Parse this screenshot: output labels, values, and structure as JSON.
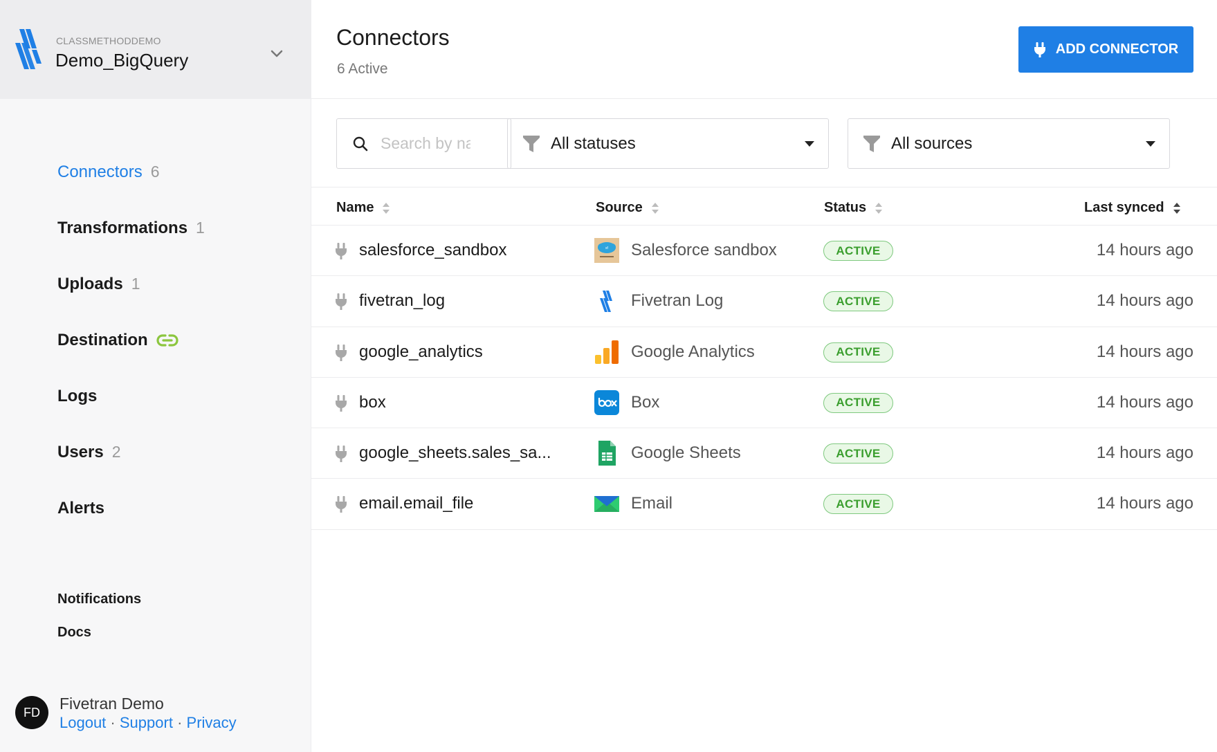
{
  "account": {
    "org": "CLASSMETHODDEMO",
    "destination": "Demo_BigQuery"
  },
  "nav": [
    {
      "label": "Connectors",
      "count": "6"
    },
    {
      "label": "Transformations",
      "count": "1"
    },
    {
      "label": "Uploads",
      "count": "1"
    },
    {
      "label": "Destination",
      "icon": "link-icon"
    },
    {
      "label": "Logs"
    },
    {
      "label": "Users",
      "count": "2"
    },
    {
      "label": "Alerts"
    }
  ],
  "sub_nav": [
    "Notifications",
    "Docs"
  ],
  "user": {
    "initials": "FD",
    "name": "Fivetran Demo",
    "logout": "Logout",
    "support": "Support",
    "privacy": "Privacy",
    "separator": "·"
  },
  "header": {
    "title": "Connectors",
    "subtitle": "6 Active",
    "add_button": "ADD CONNECTOR"
  },
  "filters": {
    "search_placeholder": "Search by name",
    "status": "All statuses",
    "source": "All sources"
  },
  "table": {
    "columns": [
      "Name",
      "Source",
      "Status",
      "Last synced"
    ],
    "rows": [
      {
        "name": "salesforce_sandbox",
        "source": "Salesforce sandbox",
        "icon": "salesforce-icon",
        "status": "ACTIVE",
        "last_synced": "14 hours ago"
      },
      {
        "name": "fivetran_log",
        "source": "Fivetran Log",
        "icon": "fivetran-icon",
        "status": "ACTIVE",
        "last_synced": "14 hours ago"
      },
      {
        "name": "google_analytics",
        "source": "Google Analytics",
        "icon": "google-analytics-icon",
        "status": "ACTIVE",
        "last_synced": "14 hours ago"
      },
      {
        "name": "box",
        "source": "Box",
        "icon": "box-icon",
        "status": "ACTIVE",
        "last_synced": "14 hours ago"
      },
      {
        "name": "google_sheets.sales_sa...",
        "source": "Google Sheets",
        "icon": "google-sheets-icon",
        "status": "ACTIVE",
        "last_synced": "14 hours ago"
      },
      {
        "name": "email.email_file",
        "source": "Email",
        "icon": "email-icon",
        "status": "ACTIVE",
        "last_synced": "14 hours ago"
      }
    ]
  },
  "colors": {
    "accent": "#1f7fe5",
    "active_badge": "#3a9e2e",
    "destination_link": "#8cc63f"
  }
}
